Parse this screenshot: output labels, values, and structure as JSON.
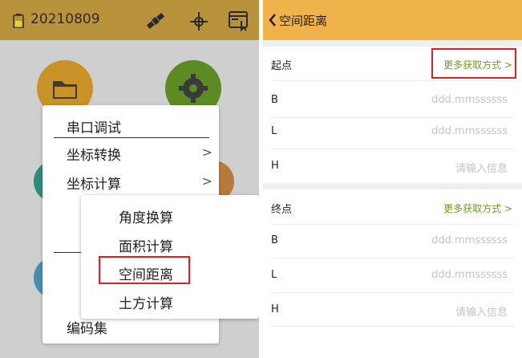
{
  "left": {
    "top_bar": {
      "date": "20210809"
    },
    "menu": {
      "items": [
        {
          "label": "串口调试",
          "has_arrow": false
        },
        {
          "label": "坐标转换",
          "has_arrow": true
        },
        {
          "label": "坐标计算",
          "has_arrow": true
        }
      ],
      "bottom_item": "编码集",
      "chevron": ">"
    },
    "submenu": {
      "items": [
        "角度换算",
        "面积计算",
        "空间距离",
        "土方计算"
      ],
      "highlighted": "空间距离"
    },
    "colors": {
      "top_bar": "#b9933c",
      "background": "#cfcfcf",
      "folder": "#c99227",
      "gear": "#5c8a23"
    }
  },
  "right": {
    "header": {
      "title": "空间距离",
      "back_icon": "chevron-left-icon"
    },
    "start": {
      "label": "起点",
      "more": "更多获取方式 >",
      "rows": [
        {
          "label": "B",
          "placeholder": "ddd.mmssssss"
        },
        {
          "label": "L",
          "placeholder": "ddd.mmssssss"
        },
        {
          "label": "H",
          "placeholder": "请输入信息"
        }
      ]
    },
    "end": {
      "label": "终点",
      "more": "更多获取方式 >",
      "rows": [
        {
          "label": "B",
          "placeholder": "ddd.mmssssss"
        },
        {
          "label": "L",
          "placeholder": "ddd.mmssssss"
        },
        {
          "label": "H",
          "placeholder": "请输入信息"
        }
      ]
    },
    "colors": {
      "header": "#f0b24b",
      "link": "#6a9e1f",
      "highlight": "#e02020"
    }
  }
}
